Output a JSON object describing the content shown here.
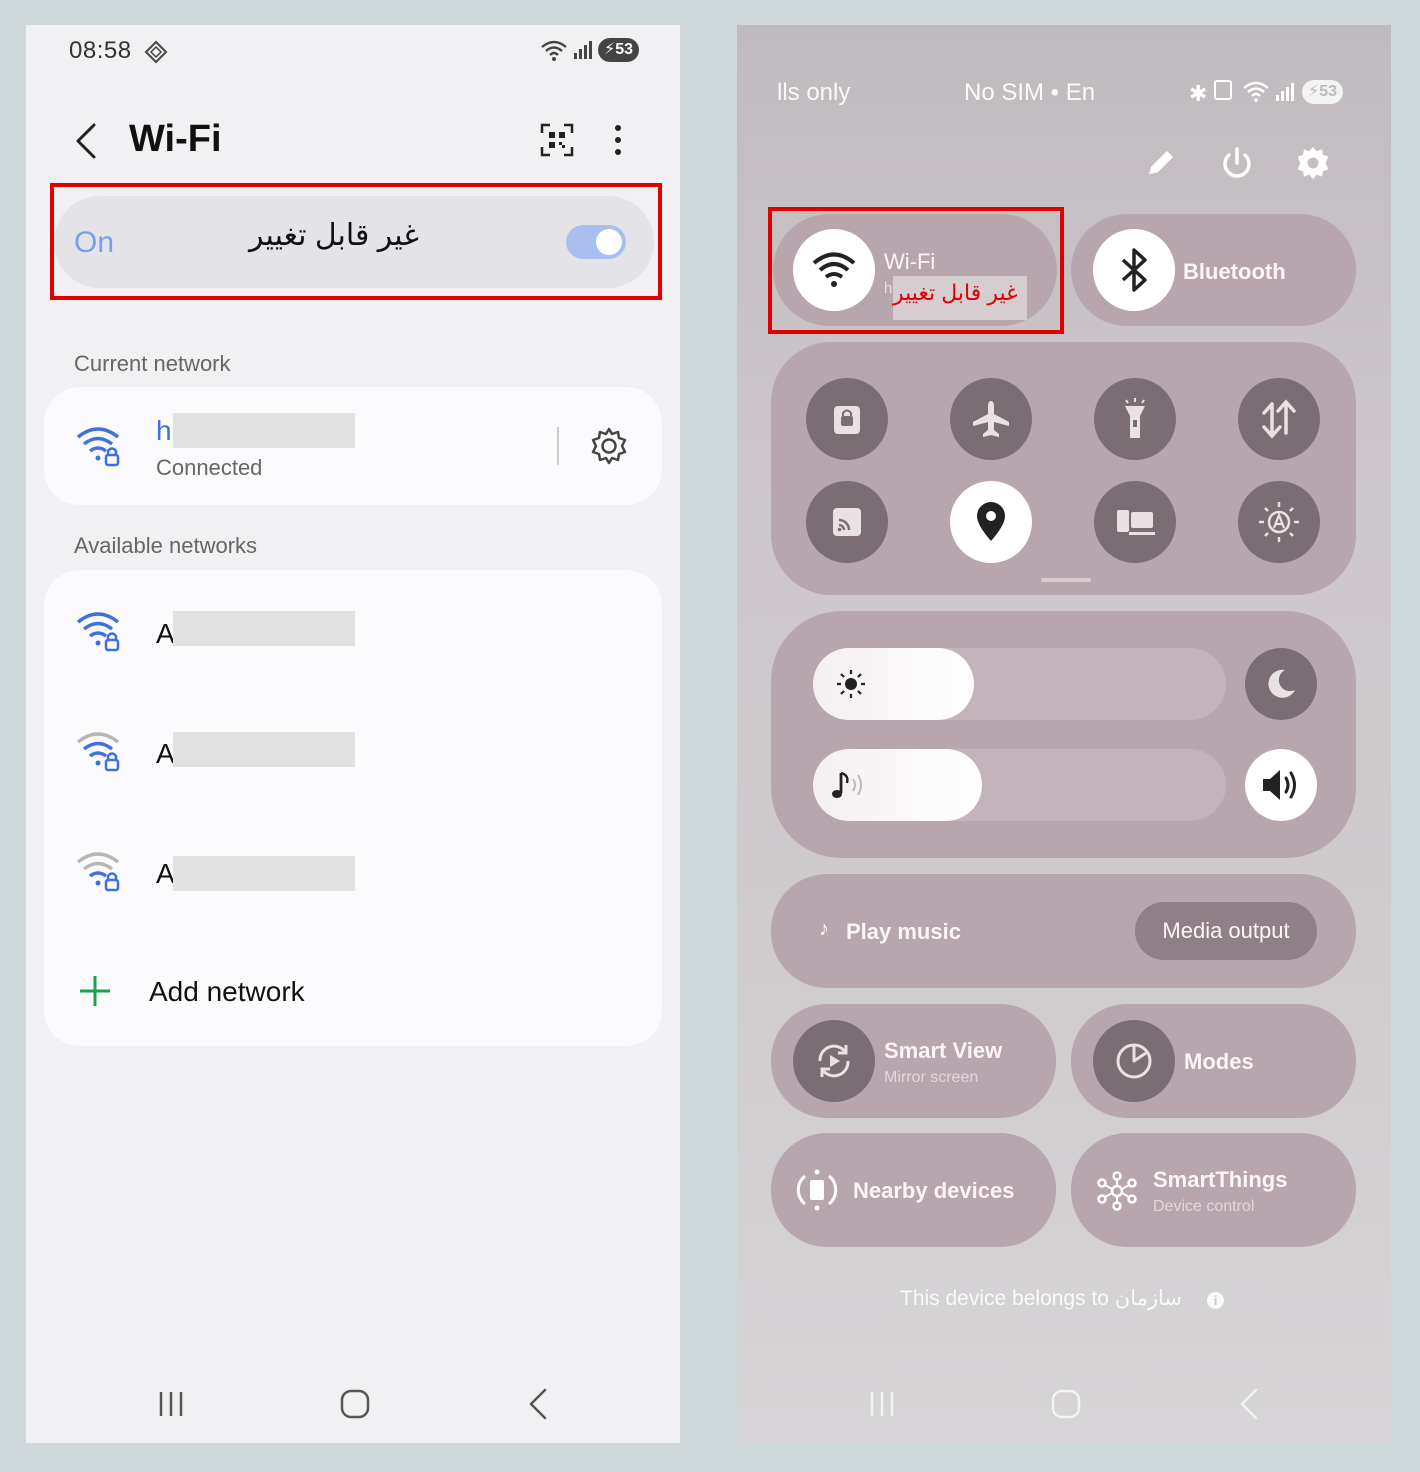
{
  "left_phone": {
    "status_bar": {
      "time": "08:58",
      "battery": "53"
    },
    "header": {
      "title": "Wi-Fi"
    },
    "wifi_toggle": {
      "state_label": "On",
      "annotation": "غیر قابل تغییر",
      "is_on": true
    },
    "current_network": {
      "section_title": "Current network",
      "name_prefix": "h",
      "status": "Connected"
    },
    "available_networks": {
      "section_title": "Available networks",
      "items": [
        {
          "name_prefix": "A"
        },
        {
          "name_prefix": "A"
        },
        {
          "name_prefix": "A"
        }
      ],
      "add_network_label": "Add network"
    },
    "colors": {
      "accent_blue": "#3f6fe0",
      "highlight_red": "#e00000",
      "add_green": "#1aa34a"
    }
  },
  "right_phone": {
    "status_bar": {
      "carrier_left": "lls only",
      "carrier_center": "No SIM • En",
      "battery": "53"
    },
    "top_actions": [
      "edit-icon",
      "power-icon",
      "settings-icon"
    ],
    "wifi_tile": {
      "label": "Wi-Fi",
      "sub_prefix": "h",
      "annotation": "غیر قابل تغییر"
    },
    "bluetooth_tile": {
      "label": "Bluetooth"
    },
    "quick_icons": [
      "lock-icon",
      "airplane-icon",
      "flashlight-icon",
      "data-transfer-icon",
      "cast-icon",
      "location-icon",
      "dex-icon",
      "auto-brightness-icon"
    ],
    "brightness_level": 0.39,
    "volume_level": 0.41,
    "media": {
      "play_label": "Play music",
      "output_label": "Media output"
    },
    "tiles": [
      {
        "title": "Smart View",
        "subtitle": "Mirror screen"
      },
      {
        "title": "Modes",
        "subtitle": ""
      },
      {
        "title": "Nearby devices",
        "subtitle": ""
      },
      {
        "title": "SmartThings",
        "subtitle": "Device control"
      }
    ],
    "footer_note": "This device belongs to سازمان"
  }
}
